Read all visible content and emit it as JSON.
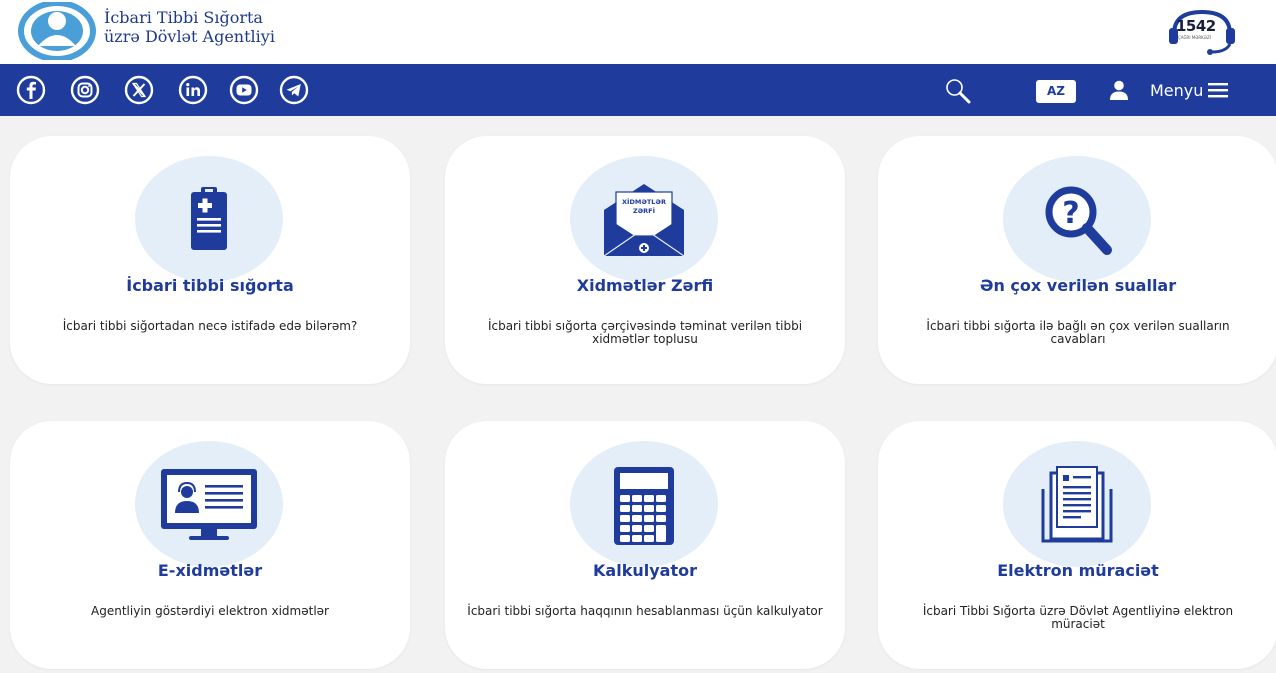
{
  "header": {
    "agency_name_line1": "İcbari Tibbi Sığorta",
    "agency_name_line2": "üzrə Dövlət Agentliyi",
    "call_center_number": "1542",
    "call_center_caption": "ÇAĞRI MƏRKƏZİ"
  },
  "nav": {
    "social_icons": [
      "facebook-icon",
      "instagram-icon",
      "x-twitter-icon",
      "linkedin-icon",
      "youtube-icon",
      "telegram-icon"
    ],
    "language": "AZ",
    "menu_label": "Menyu"
  },
  "colors": {
    "brand_blue": "#1f3c9c",
    "card_background": "#ffffff",
    "page_background": "#f2f2f2",
    "icon_circle": "#e3eef8"
  },
  "cards": [
    {
      "icon": "clipboard-medical-icon",
      "title": "İcbari tibbi sığorta",
      "description": "İcbari tibbi siğortadan necə istifadə edə bilərəm?"
    },
    {
      "icon": "envelope-icon",
      "icon_text_line1": "XİDMƏTLƏR",
      "icon_text_line2": "ZƏRFİ",
      "title": "Xidmətlər Zərfi",
      "description": "İcbari tibbi sığorta çərçivəsində təminat verilən tibbi xidmətlər toplusu"
    },
    {
      "icon": "magnifier-question-icon",
      "title": "Ən çox verilən suallar",
      "description": "İcbari tibbi sığorta ilə bağlı ən çox verilən sualların cavabları"
    },
    {
      "icon": "monitor-operator-icon",
      "title": "E-xidmətlər",
      "description": "Agentliyin göstərdiyi elektron xidmətlər"
    },
    {
      "icon": "calculator-icon",
      "title": "Kalkulyator",
      "description": "İcbari tibbi sığorta haqqının hesablanması üçün kalkulyator"
    },
    {
      "icon": "document-application-icon",
      "title": "Elektron müraciət",
      "description": "İcbari Tibbi Sığorta üzrə Dövlət Agentliyinə elektron müraciət"
    }
  ]
}
